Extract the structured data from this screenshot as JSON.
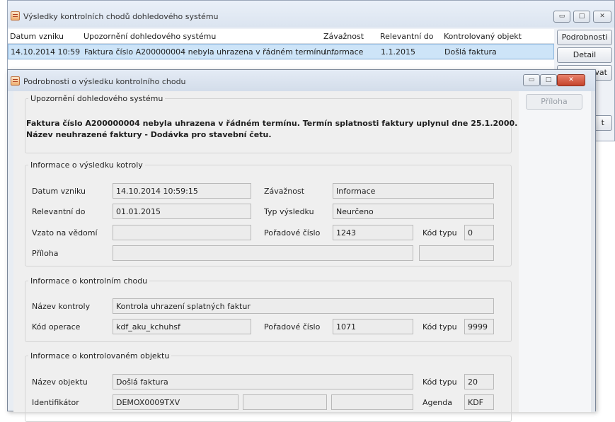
{
  "background_window": {
    "title": "Výsledky kontrolních chodů dohledového systému",
    "columns": [
      "Datum vzniku",
      "Upozornění dohledového systému",
      "Závažnost",
      "Relevantní do",
      "Kontrolovaný objekt"
    ],
    "rows": [
      [
        "14.10.2014 10:59",
        "Faktura číslo A200000004 nebyla uhrazena v řádném termínu. ...",
        "Informace",
        "1.1.2015",
        "Došlá faktura"
      ]
    ],
    "buttons": {
      "podrobnosti": "Podrobnosti",
      "detail": "Detail",
      "partial_a": "vat",
      "partial_b": "t"
    },
    "controls": {
      "minimize": "▭",
      "maximize": "□",
      "close": "✕"
    }
  },
  "dialog": {
    "title": "Podrobnosti o výsledku kontrolního chodu",
    "controls": {
      "minimize": "▭",
      "maximize": "□",
      "close": "✕"
    },
    "priloha_button": "Příloha",
    "alert_group": {
      "legend": "Upozornění dohledového systému",
      "line1": "Faktura číslo A200000004 nebyla uhrazena v řádném termínu. Termín splatnosti faktury uplynul dne 25.1.2000.",
      "line2": "Název neuhrazené faktury - Dodávka pro stavební četu."
    },
    "result_group": {
      "legend": "Informace o výsledku kotroly",
      "datum_vzniku_label": "Datum vzniku",
      "datum_vzniku": "14.10.2014 10:59:15",
      "zavaznost_label": "Závažnost",
      "zavaznost": "Informace",
      "relevantni_do_label": "Relevantní do",
      "relevantni_do": "01.01.2015",
      "typ_vysledku_label": "Typ výsledku",
      "typ_vysledku": "Neurčeno",
      "vzato_label": "Vzato na vědomí",
      "vzato": "",
      "poradove_cislo_label": "Pořadové číslo",
      "poradove_cislo": "1243",
      "kod_typu_label": "Kód typu",
      "kod_typu": "0",
      "priloha_label": "Příloha",
      "priloha": "",
      "priloha_extra": ""
    },
    "run_group": {
      "legend": "Informace o kontrolním chodu",
      "nazev_kontroly_label": "Název kontroly",
      "nazev_kontroly": "Kontrola uhrazení splatných faktur",
      "kod_operace_label": "Kód operace",
      "kod_operace": "kdf_aku_kchuhsf",
      "poradove_cislo_label": "Pořadové číslo",
      "poradove_cislo": "1071",
      "kod_typu_label": "Kód typu",
      "kod_typu": "9999"
    },
    "object_group": {
      "legend": "Informace o kontrolovaném objektu",
      "nazev_objektu_label": "Název objektu",
      "nazev_objektu": "Došlá faktura",
      "kod_typu_label": "Kód typu",
      "kod_typu": "20",
      "identifikator_label": "Identifikátor",
      "identifikator": "DEMOX0009TXV",
      "identifikator_2": "",
      "identifikator_3": "",
      "agenda_label": "Agenda",
      "agenda": "KDF"
    }
  }
}
